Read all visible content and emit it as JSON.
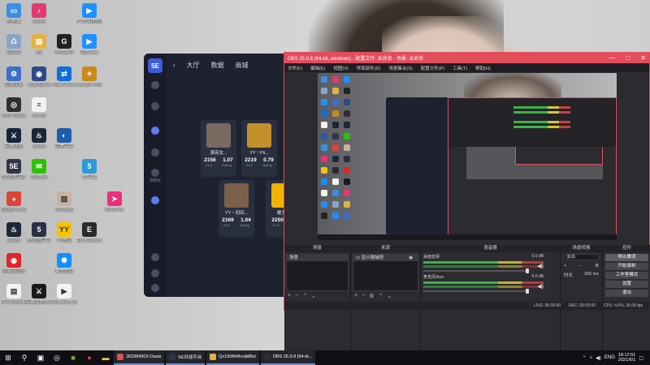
{
  "desktop_icons": [
    {
      "label": "此电脑",
      "color": "#3a8ee6",
      "glyph": "▭"
    },
    {
      "label": "iTunes",
      "color": "#e23a6e",
      "glyph": "♪"
    },
    {
      "label": "5个好用的直播工具",
      "color": "#1e90ff",
      "glyph": "▶"
    },
    {
      "label": "回收站",
      "color": "#8aa4c8",
      "glyph": "♺"
    },
    {
      "label": "cfg",
      "color": "#e3b341",
      "glyph": "▤"
    },
    {
      "label": "WeGame",
      "color": "#222222",
      "glyph": "G"
    },
    {
      "label": "直播工具",
      "color": "#1e90ff",
      "glyph": "▶"
    },
    {
      "label": "控制面板",
      "color": "#3b6fc9",
      "glyph": "⚙"
    },
    {
      "label": "TeamSpeak",
      "color": "#2c4a8a",
      "glyph": "◉"
    },
    {
      "label": "TeamViewer",
      "color": "#0e6fd8",
      "glyph": "⇄"
    },
    {
      "label": "Counter-Strike",
      "color": "#c98a1c",
      "glyph": "✦"
    },
    {
      "label": "OBS Studio",
      "color": "#302e31",
      "glyph": "◎"
    },
    {
      "label": "ssc.txt",
      "color": "#f2f2f2",
      "glyph": "≡"
    },
    {
      "label": "英雄联盟",
      "color": "#16263c",
      "glyph": "⚔"
    },
    {
      "label": "Steam",
      "color": "#1b2838",
      "glyph": "♨"
    },
    {
      "label": "完美平台",
      "color": "#1f5ea8",
      "glyph": "◐"
    },
    {
      "label": "5E对战平台",
      "color": "#30344a",
      "glyph": "5E"
    },
    {
      "label": "WeChat",
      "color": "#2dc100",
      "glyph": "✉"
    },
    {
      "label": "5E平台",
      "color": "#2a9bd8",
      "glyph": "5"
    },
    {
      "label": "Google Chrome",
      "color": "#db4437",
      "glyph": "◕"
    },
    {
      "label": "1566.jpg",
      "color": "#c8b3a0",
      "glyph": "▨"
    },
    {
      "label": "OneDrive",
      "color": "#ec2f7a",
      "glyph": "➤"
    },
    {
      "label": "Steam",
      "color": "#1b2838",
      "glyph": "♨"
    },
    {
      "label": "B5对战平台",
      "color": "#2c2f44",
      "glyph": "5"
    },
    {
      "label": "YY语音",
      "color": "#f5c400",
      "glyph": "YY"
    },
    {
      "label": "Epic Games Launcher",
      "color": "#2a2a2a",
      "glyph": "E"
    },
    {
      "label": "网易云音乐",
      "color": "#e02626",
      "glyph": "◉"
    },
    {
      "label": "暴雪战网",
      "color": "#148eff",
      "glyph": "✺"
    },
    {
      "label": "Free Downlo...",
      "color": "#f2f2f2",
      "glyph": "▤"
    },
    {
      "label": "英雄联盟WeGame版",
      "color": "#1a1a1a",
      "glyph": "⚔"
    },
    {
      "label": "1mk.pid入之路,Wrat...",
      "color": "#f2f2f2",
      "glyph": "▶"
    }
  ],
  "game_client": {
    "nav": [
      "大厅",
      "数据",
      "商城"
    ],
    "side_label": "转转玩",
    "cards": [
      {
        "name": "漂亮女...",
        "stat1": "2156",
        "stat2": "1.07",
        "lbl1": "ELO",
        "lbl2": "Rating",
        "avatar": "#7a6a62"
      },
      {
        "name": "YY丶Pli...",
        "stat1": "2219",
        "stat2": "0.79",
        "lbl1": "ELO",
        "lbl2": "Rating",
        "avatar": "#c4902a"
      },
      {
        "name": "YY丶初田...",
        "stat1": "2169",
        "stat2": "1.04",
        "lbl1": "ELO",
        "lbl2": "Rating",
        "avatar": "#7a6048"
      },
      {
        "name": "暖力等",
        "stat1": "2250",
        "stat2": "",
        "lbl1": "ELO",
        "lbl2": "",
        "avatar": "#f0b400"
      }
    ]
  },
  "obs": {
    "title": "OBS 25.0.8 (64-bit, windows) - 配置文件: 未命名 - 场景: 未命名",
    "controls": [
      "—",
      "□",
      "✕"
    ],
    "menu": [
      "文件(F)",
      "编辑(E)",
      "视图(V)",
      "停靠部件(D)",
      "场景集合(S)",
      "配置文件(P)",
      "工具(T)",
      "帮助(H)"
    ],
    "docks": {
      "scenes": {
        "title": "场景",
        "items": [
          "场景"
        ]
      },
      "sources": {
        "title": "来源",
        "items": [
          "显示器捕获"
        ]
      },
      "mixer": {
        "title": "混音器",
        "channels": [
          {
            "name": "桌面音频",
            "value": "0.0 dB"
          },
          {
            "name": "麦克风/Aux",
            "value": "0.0 dB"
          }
        ]
      },
      "transitions": {
        "title": "场景转换",
        "type": "淡出",
        "duration_label": "时长",
        "duration": "300 ms"
      },
      "controls": {
        "title": "控件",
        "buttons": [
          "停止推流",
          "开始录制",
          "工作室模式",
          "设置",
          "退出"
        ]
      }
    },
    "status": {
      "live": "LIVE: 00:00:00",
      "rec": "REC: 00:00:00",
      "cpu": "CPU: 4.0%, 30.00 fps"
    }
  },
  "taskbar": {
    "apps": [
      {
        "label": "263384003-Oasis",
        "color": "#d9534f"
      },
      {
        "label": "5E对战平台",
        "color": "#30344a"
      },
      {
        "label": "Qx15t9N4hvqM8ul",
        "color": "#e3b341"
      },
      {
        "label": "OBS 25.0.8 (64-bi...",
        "color": "#302e31"
      }
    ],
    "lang": "ENG",
    "time": "18:12:51",
    "date": "2021/6/1"
  }
}
